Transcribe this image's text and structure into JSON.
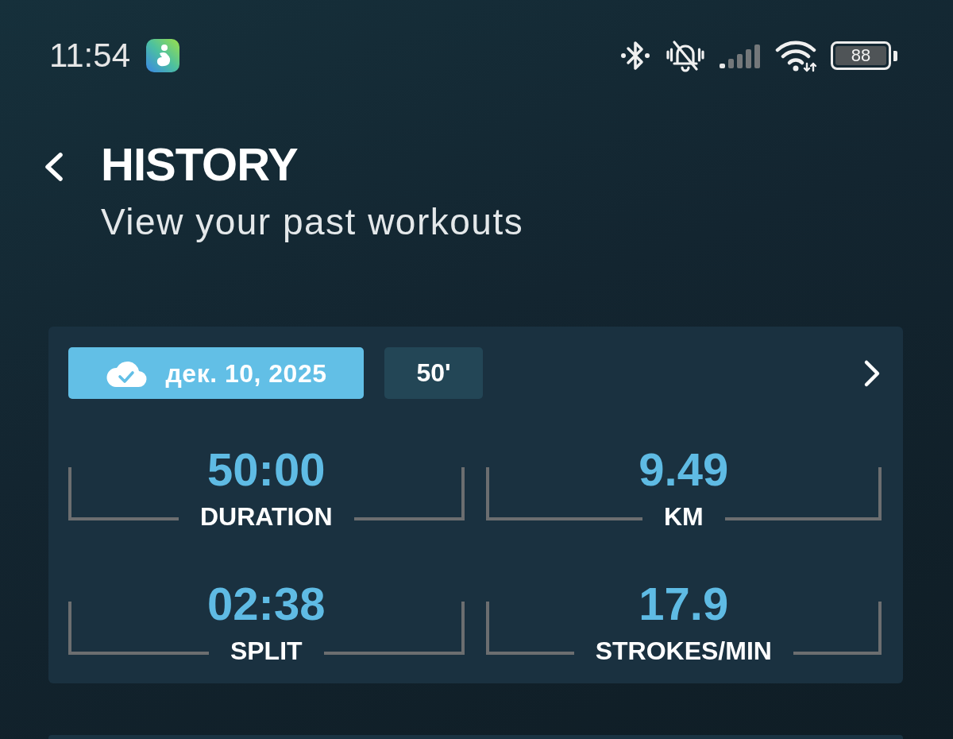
{
  "status_bar": {
    "time": "11:54",
    "battery": "88"
  },
  "header": {
    "title": "HISTORY",
    "subtitle": "View your past workouts"
  },
  "workouts": [
    {
      "synced": true,
      "date": "дек. 10, 2025",
      "duration_tag": "50'",
      "stats": [
        {
          "value": "50:00",
          "label": "DURATION"
        },
        {
          "value": "9.49",
          "label": "KM"
        },
        {
          "value": "02:38",
          "label": "SPLIT"
        },
        {
          "value": "17.9",
          "label": "STROKES/MIN"
        }
      ]
    }
  ]
}
